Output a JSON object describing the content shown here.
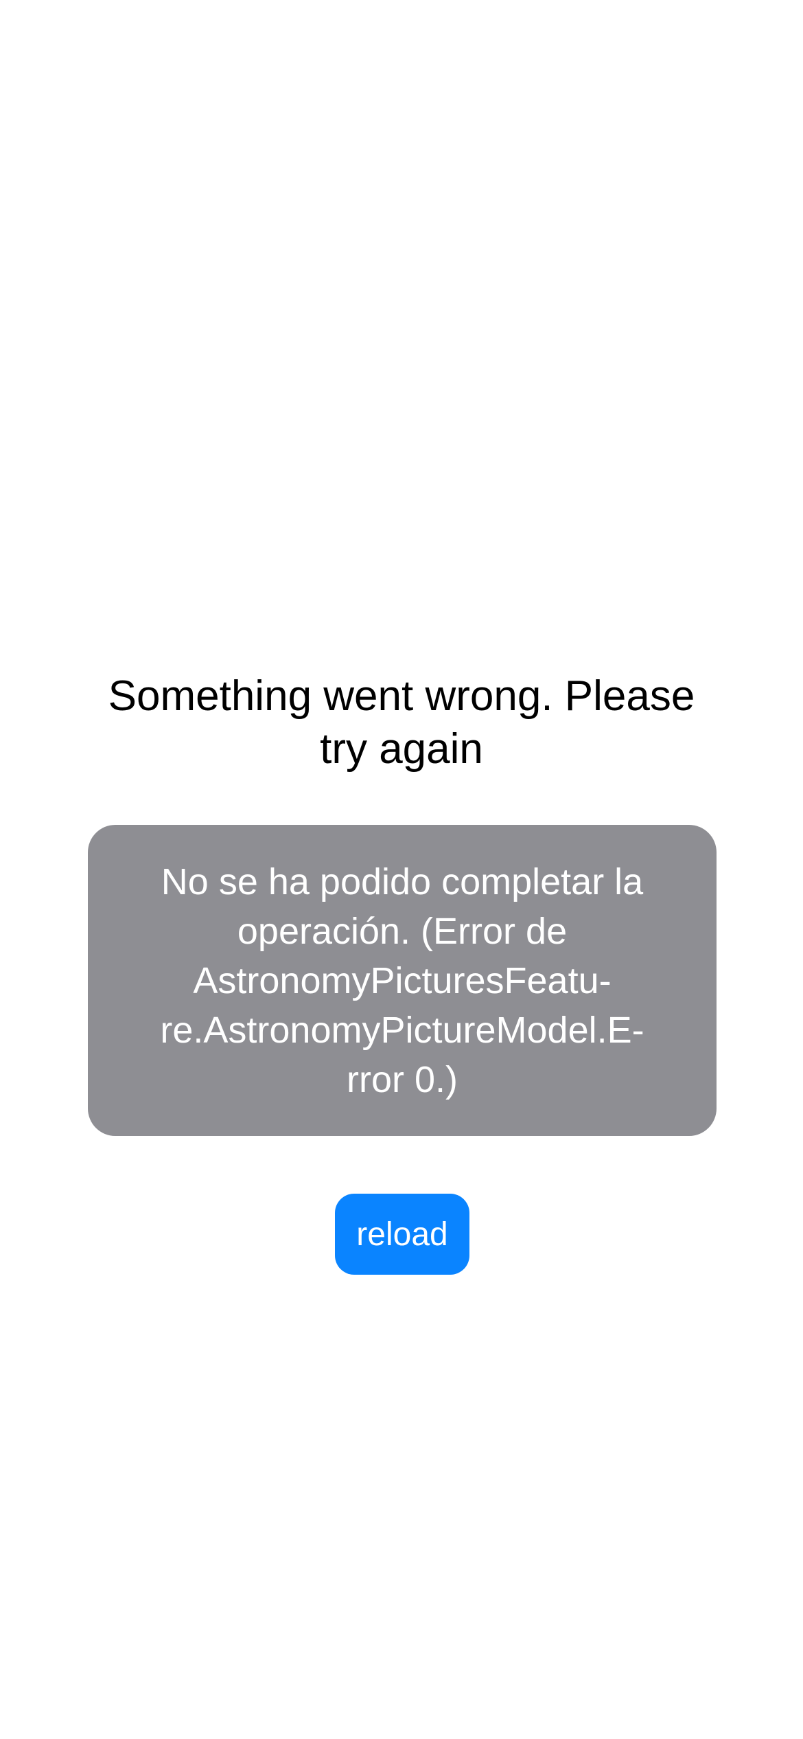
{
  "error_screen": {
    "message": "Something went wrong. Please try again",
    "error_detail": "No se ha podido completar la\noperación. (Error de\nAstronomyPicturesFeatu-\nre.AstronomyPictureModel.E-\nrror 0.)",
    "reload_label": "reload"
  },
  "colors": {
    "background": "#ffffff",
    "error_box": "#8e8e93",
    "accent": "#0a84ff"
  }
}
